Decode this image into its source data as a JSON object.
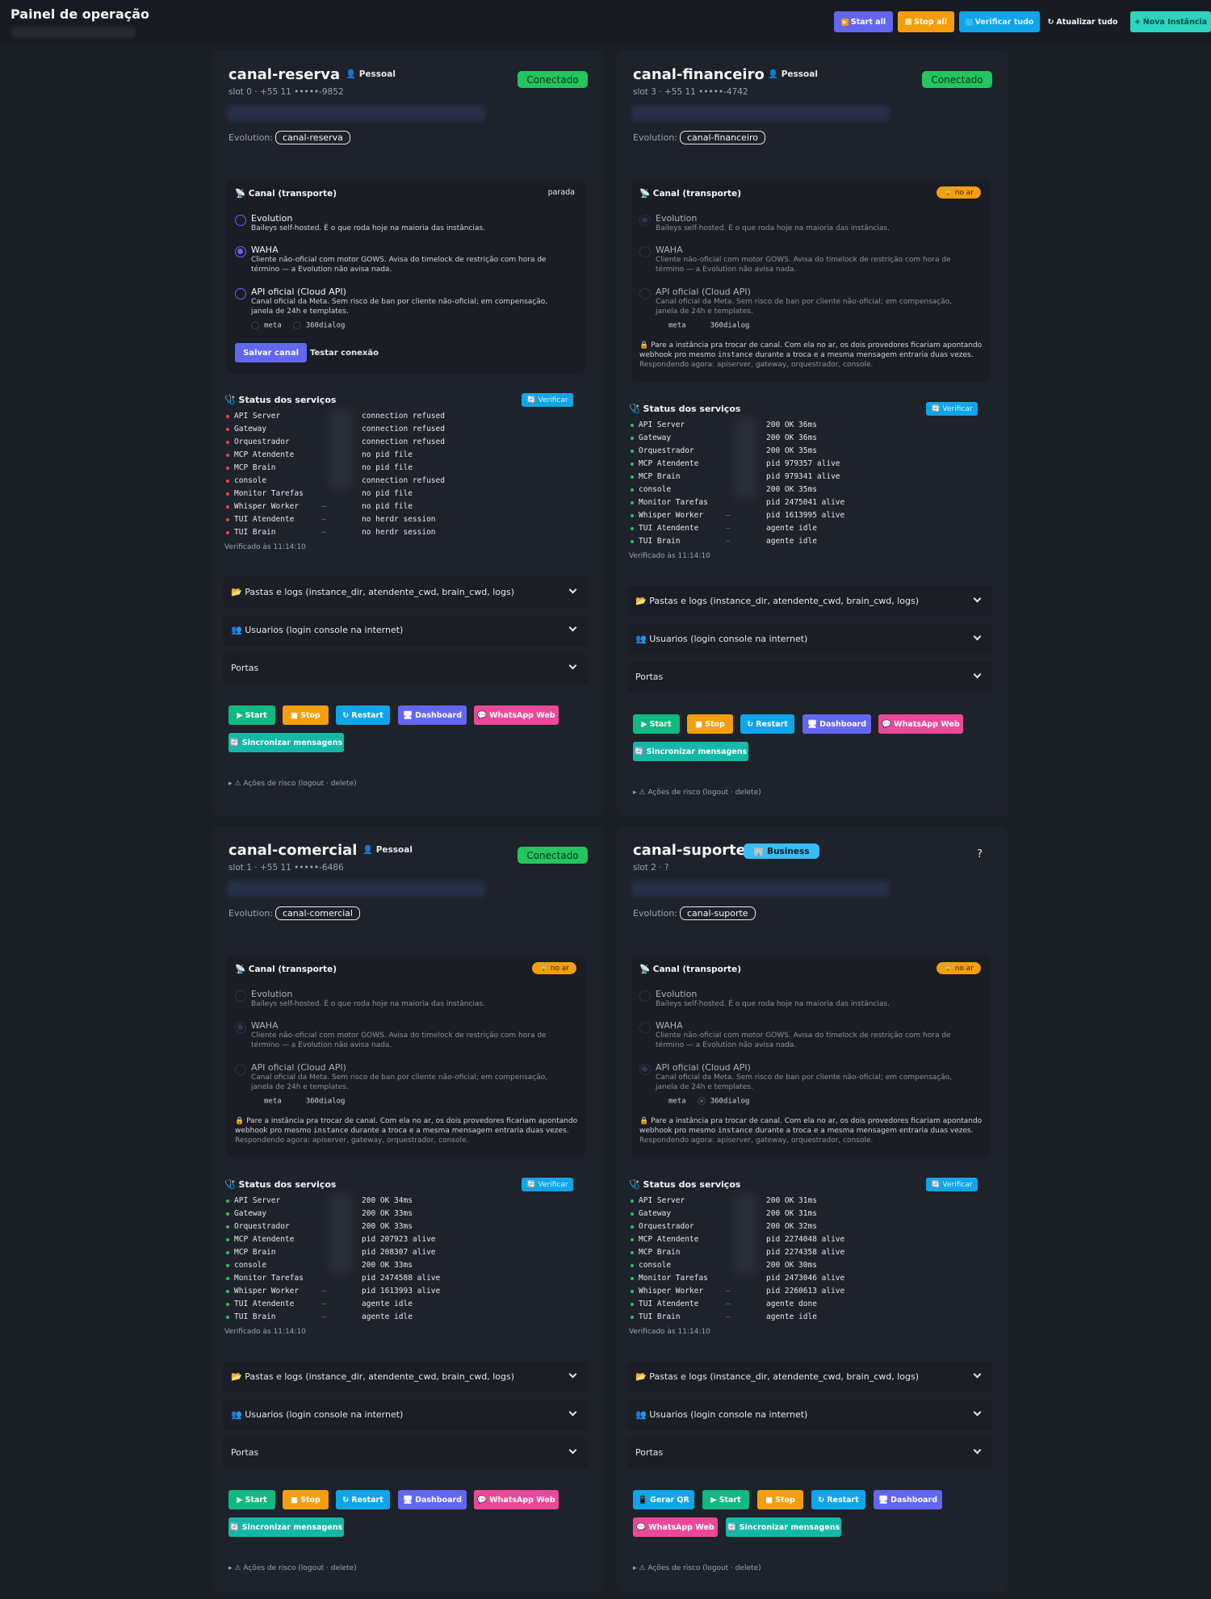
{
  "header": {
    "title": "Painel de operação",
    "buttons": {
      "start_all": "Start all",
      "stop_all": "Stop all",
      "verificar_tudo": "Verificar tudo",
      "atualizar_tudo": "Atualizar tudo",
      "nova_instancia": "Nova Instância"
    }
  },
  "labels": {
    "evolution": "Evolution:",
    "canal_transporte": "Canal (transporte)",
    "opt_evolution": "Evolution",
    "opt_evolution_desc": "Baileys self-hosted. É o que roda hoje na maioria das instâncias.",
    "opt_waha": "WAHA",
    "opt_waha_desc": "Cliente não-oficial com motor GOWS. Avisa do timelock de restrição com hora de término — a Evolution não avisa nada.",
    "opt_api": "API oficial (Cloud API)",
    "opt_api_desc": "Canal oficial da Meta. Sem risco de ban por cliente não-oficial; em compensação, janela de 24h e templates.",
    "prov_meta": "meta",
    "prov_360": "360dialog",
    "parada": "parada",
    "no_ar": "no ar",
    "salvar_canal": "Salvar canal",
    "testar_conexao": "Testar conexão",
    "warn_pre": "Pare a instância pra trocar de canal. Com ela no ar, os dois provedores ficariam apontando webhook pro mesmo ",
    "warn_mono": "instance",
    "warn_post": " durante a troca e a mesma mensagem entraria duas vezes.",
    "respondendo": "Respondendo agora: apiserver, gateway, orquestrador, console.",
    "status_servicos": "Status dos serviços",
    "verificar": "Verificar",
    "pastas": "Pastas e logs (instance_dir, atendente_cwd, brain_cwd, logs)",
    "usuarios": "Usuarios (login console na internet)",
    "portas": "Portas",
    "start": "Start",
    "stop": "Stop",
    "restart": "Restart",
    "dashboard": "Dashboard",
    "whatsapp_web": "WhatsApp Web",
    "sincronizar": "Sincronizar mensagens",
    "gerar_qr": "Gerar QR",
    "acoes_risco": "Ações de risco (logout · delete)",
    "dash": "—",
    "connected": "Conectado",
    "unknown_status": "?"
  },
  "instances": [
    {
      "name": "canal-reserva",
      "type": "Pessoal",
      "slot": "slot 0 · +55 11 •••••-9852",
      "evolution": "canal-reserva",
      "services": [
        "connection refused",
        "connection refused",
        "connection refused",
        "no pid file",
        "no pid file",
        "connection refused",
        "no pid file",
        "no pid file",
        "no herdr session",
        "no herdr session"
      ],
      "checked": "Verificado às 11:14:10"
    },
    {
      "name": "canal-financeiro",
      "type": "Pessoal",
      "slot": "slot 3 · +55 11 •••••-4742",
      "evolution": "canal-financeiro",
      "services": [
        "200 OK 36ms",
        "200 OK 36ms",
        "200 OK 35ms",
        "pid 979357 alive",
        "pid 979341 alive",
        "200 OK 35ms",
        "pid 2475041 alive",
        "pid 1613995 alive",
        "agente idle",
        "agente idle"
      ],
      "checked": "Verificado às 11:14:10"
    },
    {
      "name": "canal-comercial",
      "type": "Pessoal",
      "slot": "slot 1 · +55 11 •••••-6486",
      "evolution": "canal-comercial",
      "services": [
        "200 OK 34ms",
        "200 OK 33ms",
        "200 OK 33ms",
        "pid 207923 alive",
        "pid 208307 alive",
        "200 OK 33ms",
        "pid 2474588 alive",
        "pid 1613993 alive",
        "agente idle",
        "agente idle"
      ],
      "checked": "Verificado às 11:14:10"
    },
    {
      "name": "canal-suporte",
      "type": "Business",
      "slot": "slot 2 · ?",
      "evolution": "canal-suporte",
      "services": [
        "200 OK 31ms",
        "200 OK 31ms",
        "200 OK 32ms",
        "pid 2274048 alive",
        "pid 2274358 alive",
        "200 OK 30ms",
        "pid 2473046 alive",
        "pid 2260613 alive",
        "agente done",
        "agente idle"
      ],
      "checked": "Verificado às 11:14:10"
    }
  ],
  "service_names": [
    "API Server",
    "Gateway",
    "Orquestrador",
    "MCP Atendente",
    "MCP Brain",
    "console",
    "Monitor Tarefas",
    "Whisper Worker",
    "TUI Atendente",
    "TUI Brain"
  ],
  "colors": {
    "ok": "#22c55e",
    "error": "#ef4444",
    "accent": "#6366f1",
    "start": "#10b981",
    "stop": "#f59e0b",
    "restart": "#0ea5e9",
    "dashboard": "#6366f1",
    "whatsapp": "#ec4899",
    "sync": "#14b8a6"
  }
}
